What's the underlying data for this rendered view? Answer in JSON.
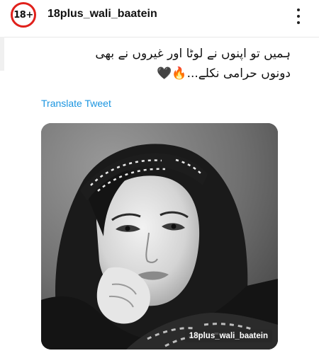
{
  "header": {
    "avatar_text": "18+",
    "username": "18plus_wali_baatein",
    "more_icon": "more-vertical-icon"
  },
  "tweet": {
    "line1": "ہمیں تو اپنوں نے لوٹا اور غیروں نے بھی",
    "line2": "دونوں حرامی نکلے...🔥🖤",
    "translate_label": "Translate Tweet"
  },
  "media": {
    "watermark": "18plus_wali_baatein"
  },
  "colors": {
    "avatar_ring": "#e0201b",
    "link": "#1b95e0"
  }
}
